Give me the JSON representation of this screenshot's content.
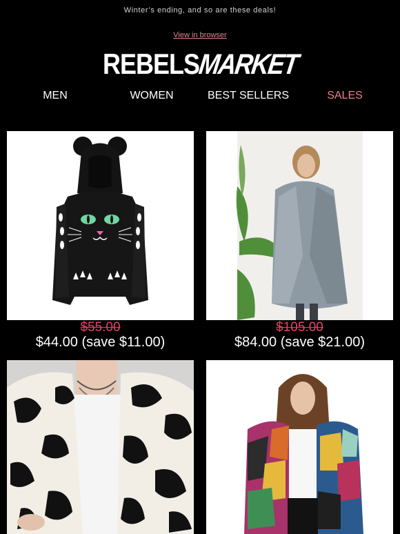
{
  "preheader": "Winter’s ending, and so are these deals!",
  "view_in_browser": "View in browser",
  "logo": {
    "left": "REBELS",
    "right": "MARKET"
  },
  "nav": [
    {
      "label": "MEN"
    },
    {
      "label": "WOMEN"
    },
    {
      "label": "BEST SELLERS"
    },
    {
      "label": "SALES"
    }
  ],
  "colors": {
    "background": "#000000",
    "sale_nav": "#ec7f8f",
    "old_price": "#ee3f67"
  },
  "products": [
    {
      "old_price": "$55.00",
      "new_price": "$44.00 (save $11.00)",
      "image": "black-cat-ear-hoodie"
    },
    {
      "old_price": "$105.00",
      "new_price": "$84.00 (save $21.00)",
      "image": "grey-draped-wool-coat"
    },
    {
      "image": "cow-print-faux-fur-jacket"
    },
    {
      "image": "multicolor-faux-fur-coat"
    }
  ]
}
